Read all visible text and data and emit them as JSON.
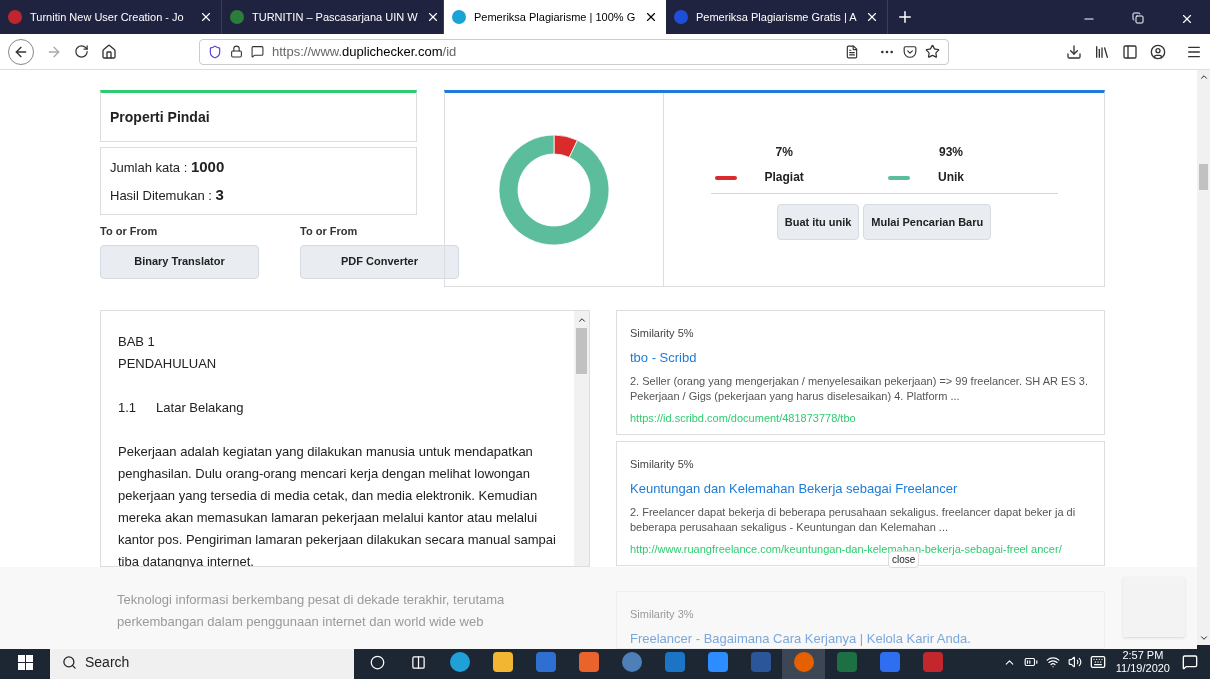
{
  "browser_tabs": [
    {
      "title": "Turnitin New User Creation - Jo",
      "selected": false
    },
    {
      "title": "TURNITIN – Pascasarjana UIN W",
      "selected": false
    },
    {
      "title": "Pemeriksa Plagiarisme | 100% G",
      "selected": true
    },
    {
      "title": "Pemeriksa Plagiarisme Gratis | A",
      "selected": false
    }
  ],
  "address_bar": {
    "url_prefix": "https://www.",
    "url_domain": "duplichecker.com",
    "url_suffix": "/id"
  },
  "scan_properties": {
    "title": "Properti Pindai",
    "word_count_label": "Jumlah kata : ",
    "word_count": "1000",
    "results_label": "Hasil Ditemukan : ",
    "results": "3"
  },
  "tools": [
    {
      "label": "To or From",
      "button": "Binary Translator"
    },
    {
      "label": "To or From",
      "button": "PDF Converter"
    }
  ],
  "stats": [
    {
      "percent": "7%",
      "color": "#d92b2b"
    },
    {
      "percent": "93%",
      "color": "#5bbd9b"
    }
  ],
  "chart_data": {
    "type": "donut",
    "categories": [
      "Plagiat",
      "Unik"
    ],
    "values": [
      7,
      93
    ]
  },
  "actions": [
    "Buat itu unik",
    "Mulai Pencarian Baru"
  ],
  "document": {
    "lines": [
      "BAB 1",
      "PENDAHULUAN"
    ],
    "section_number": "1.1",
    "section_title": "Latar Belakang",
    "paragraph": "Pekerjaan adalah kegiatan yang dilakukan manusia untuk mendapatkan penghasilan. Dulu orang-orang mencari kerja dengan melihat lowongan pekerjaan yang tersedia di media cetak, dan media elektronik. Kemudian mereka akan memasukan lamaran pekerjaan melalui kantor atau melalui kantor pos. Pengiriman lamaran pekerjaan dilakukan secara manual sampai tiba datangnya internet.",
    "faded_paragraph": "Teknologi informasi berkembang pesat di dekade terakhir, terutama perkembangan dalam penggunaan internet dan world wide web"
  },
  "results": [
    {
      "similarity": "Similarity 5%",
      "title": "tbo - Scribd",
      "snippet": "2. Seller (orang yang mengerjakan / menyelesaikan pekerjaan) => 99 freelancer. SH AR ES 3. Pekerjaan / Gigs (pekerjaan yang harus diselesaikan) 4. Platform ...",
      "url": "https://id.scribd.com/document/481873778/tbo"
    },
    {
      "similarity": "Similarity 5%",
      "title": "Keuntungan dan Kelemahan Bekerja sebagai Freelancer",
      "snippet": "2. Freelancer dapat bekerja di beberapa perusahaan sekaligus. freelancer dapat beker ja di beberapa perusahaan sekaligus - Keuntungan dan Kelemahan ...",
      "url": "http://www.ruangfreelance.com/keuntungan-dan-kelemahan-bekerja-sebagai-freel ancer/"
    }
  ],
  "faded_result": {
    "similarity": "Similarity 3%",
    "title": "Freelancer - Bagaimana Cara Kerjanya | Kelola Karir Anda."
  },
  "ad_close": "close",
  "taskbar": {
    "search": "Search",
    "time": "2:57 PM",
    "date": "11/19/2020",
    "apps": [
      {
        "kind": "edge",
        "selected": false
      },
      {
        "kind": "folder",
        "selected": false
      },
      {
        "kind": "store",
        "selected": false
      },
      {
        "kind": "media",
        "selected": false
      },
      {
        "kind": "calc",
        "selected": false
      },
      {
        "kind": "mail",
        "selected": false
      },
      {
        "kind": "zoom",
        "selected": false
      },
      {
        "kind": "word",
        "selected": false
      },
      {
        "kind": "firefox",
        "selected": true
      },
      {
        "kind": "excel",
        "selected": false
      },
      {
        "kind": "wps",
        "selected": false
      },
      {
        "kind": "app",
        "selected": false
      }
    ]
  }
}
